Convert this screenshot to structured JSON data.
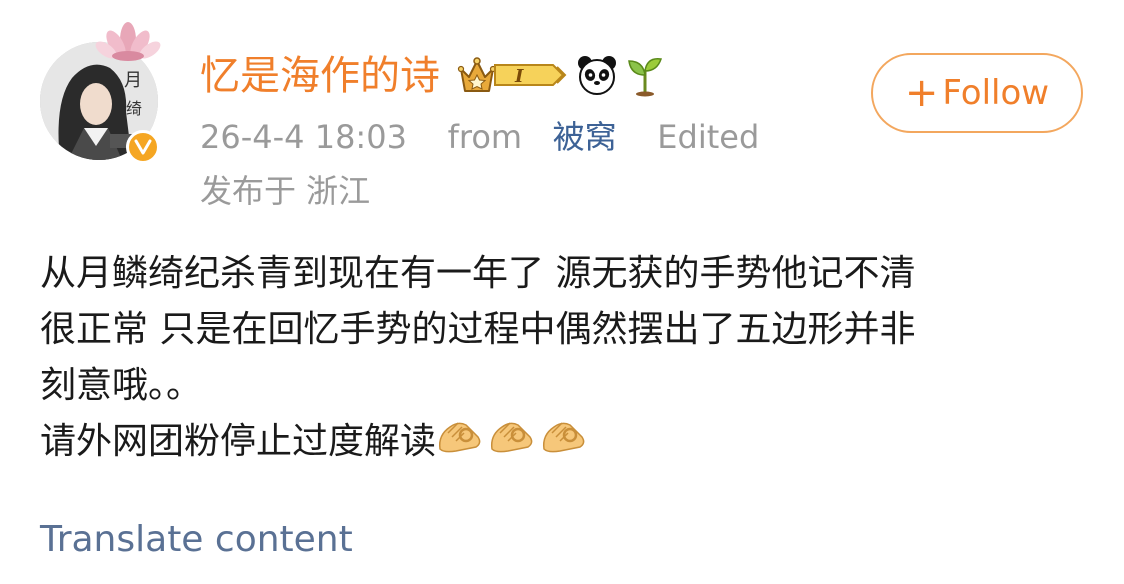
{
  "user": {
    "name": "忆是海作的诗",
    "member_level": "I",
    "verified": true
  },
  "post": {
    "date": "26-4-4 18:03",
    "from_label": "from",
    "source": "被窝",
    "edited": "Edited",
    "location": "发布于 浙江",
    "content_lines": [
      "从月鳞绮纪杀青到现在有一年了 源无获的手势他记不清",
      "很正常 只是在回忆手势的过程中偶然摆出了五边形并非",
      "刻意哦。。",
      "请外网团粉停止过度解读"
    ],
    "trailing_emoji": "ok-hand-emoji x3"
  },
  "follow": {
    "plus": "+",
    "label": "Follow"
  },
  "translate_label": "Translate content",
  "colors": {
    "accent": "#f07f2b",
    "link": "#3d6296",
    "meta_gray": "#9a9a9a",
    "translate": "#5a7194"
  }
}
